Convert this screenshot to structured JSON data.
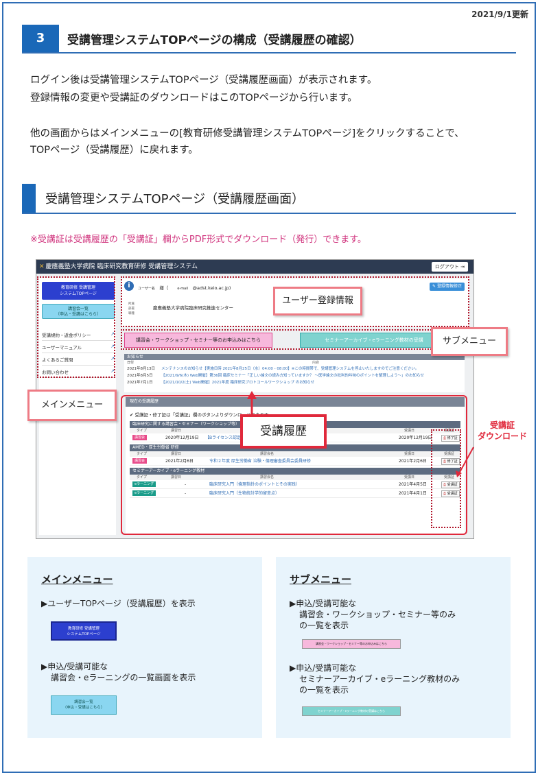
{
  "header": {
    "updated": "2021/9/1更新",
    "section_number": "3",
    "section_title": "受講管理システムTOPページの構成（受講履歴の確認）"
  },
  "intro": {
    "line1": "ログイン後は受講管理システムTOPページ（受講履歴画面）が表示されます。",
    "line2": "登録情報の変更や受講証のダウンロードはこのTOPページから行います。",
    "line3": "他の画面からはメインメニューの[教育研修受講管理システムTOPページ]をクリックすることで、",
    "line4": "TOPページ（受講履歴）に戻れます。"
  },
  "subsection_title": "受講管理システムTOPページ（受講履歴画面）",
  "note": "※受講証は受講履歴の「受講証」欄からPDF形式でダウンロード（発行）できます。",
  "screenshot": {
    "app_title": "慶應義塾大学病院 臨床研究教育研修 受講管理システム",
    "logout": "ログアウト",
    "nav": {
      "top_button": [
        "教育研修 受講管理",
        "システムTOPページ"
      ],
      "list_button": [
        "講習会一覧",
        "（申込・受講はこちら）"
      ],
      "links": [
        "受講規約・返金ポリシー",
        "ユーザーマニュアル",
        "よくあるご質問",
        "お問い合わせ"
      ]
    },
    "user": {
      "name_label": "ユーザー名",
      "name_suffix": "様（",
      "email_label": "e-mail",
      "email": "@adst.keio.ac.jp)",
      "edit": "登録情報修正",
      "affiliation_labels": [
        "所属",
        "部署",
        "職種"
      ],
      "affiliation": "慶應義塾大学病院臨床研究推進センター"
    },
    "submenu": {
      "pink": "講習会・ワークショップ・セミナー等のお申込みはこちら",
      "teal": "セミナーアーカイブ・eラーニング教材の受講"
    },
    "news": {
      "title": "お知らせ",
      "col_date": "日付",
      "col_content": "内容",
      "rows": [
        {
          "date": "2021年8月13日",
          "text": "メンテナンスのお知らせ【実施日時 2021年8月25日（水）04:00 - 08:00】※この時間帯で、受講管理システムを停止いたしますのでご注意ください。"
        },
        {
          "date": "2021年8月5日",
          "text": "【2021/9/6(木) Web開催】第36回 臨床セミナー「正しい論文の読み方知っていますか？ ～医学論文の批判的吟味のポイントを整理しよう～」のお知らせ"
        },
        {
          "date": "2021年7月1日",
          "text": "【2021/10/2(土) Web開催】2021年度 臨床研究プロトコールワークショップ のお知らせ"
        }
      ]
    },
    "history": {
      "title": "現在の受講履歴",
      "note": "✔ 受講証・修了証は「受講証」欄のボタンよりダウンロードできます。",
      "cols": {
        "type": "タイプ",
        "date": "講習日",
        "name": "講習会名",
        "attended": "受講日",
        "cert": "受講証"
      },
      "groups": [
        {
          "title": "臨床研究に関する講習会・セミナー（ワークショップ等）",
          "rows": [
            {
              "type": "講習会",
              "date": "2020年12月19日",
              "name": "【Bライセンス認定講習会】",
              "attended": "2020年12月19日",
              "cert": "修了証",
              "elearn": false
            }
          ]
        },
        {
          "title": "AMED・厚生労働省 研修",
          "rows": [
            {
              "type": "講習会",
              "date": "2021年2月6日",
              "name": "令和２年度 厚生労働省 治験・倫理審査委員会委員研修",
              "attended": "2021年2月6日",
              "cert": "修了証",
              "elearn": false
            }
          ]
        },
        {
          "title": "セミナーアーカイブ・eラーニング教材",
          "rows": [
            {
              "type": "eラーニング",
              "date": "-",
              "name": "臨床研究入門（倫理指針のポイントとその実践）",
              "attended": "2021年4月5日",
              "cert": "受講証",
              "elearn": true
            },
            {
              "type": "eラーニング",
              "date": "-",
              "name": "臨床研究入門（生物統計学的留意点）",
              "attended": "2021年4月1日",
              "cert": "受講証",
              "elearn": true
            }
          ]
        }
      ]
    }
  },
  "callouts": {
    "user_info": "ユーザー登録情報",
    "submenu": "サブメニュー",
    "main_menu": "メインメニュー",
    "history": "受講履歴",
    "download": [
      "受講証",
      "ダウンロード"
    ]
  },
  "panels": {
    "main": {
      "title": "メインメニュー",
      "item1": "▶ユーザーTOPページ（受講履歴）を表示",
      "item2a": "▶申込/受講可能な",
      "item2b": "講習会・eラーニングの一覧画面を表示",
      "mini1": [
        "教育研修 受講管理",
        "システムTOPページ"
      ],
      "mini2": [
        "講習会一覧",
        "（申込・受講はこちら）"
      ]
    },
    "sub": {
      "title": "サブメニュー",
      "item1a": "▶申込/受講可能な",
      "item1b": "講習会・ワークショップ・セミナー等のみ",
      "item1c": "の一覧を表示",
      "item2a": "▶申込/受講可能な",
      "item2b": "セミナーアーカイブ・eラーニング教材のみ",
      "item2c": "の一覧を表示",
      "mini_pink": "講習会・ワークショップ・セミナー等のお申込みはこちら",
      "mini_teal": "セミナーアーカイブ・eラーニング教材の受講はこちら"
    }
  },
  "colors": {
    "accent": "#1a68b8",
    "callout": "#e0283b",
    "pink": "#f7b8dc",
    "teal": "#7fd3cf"
  }
}
